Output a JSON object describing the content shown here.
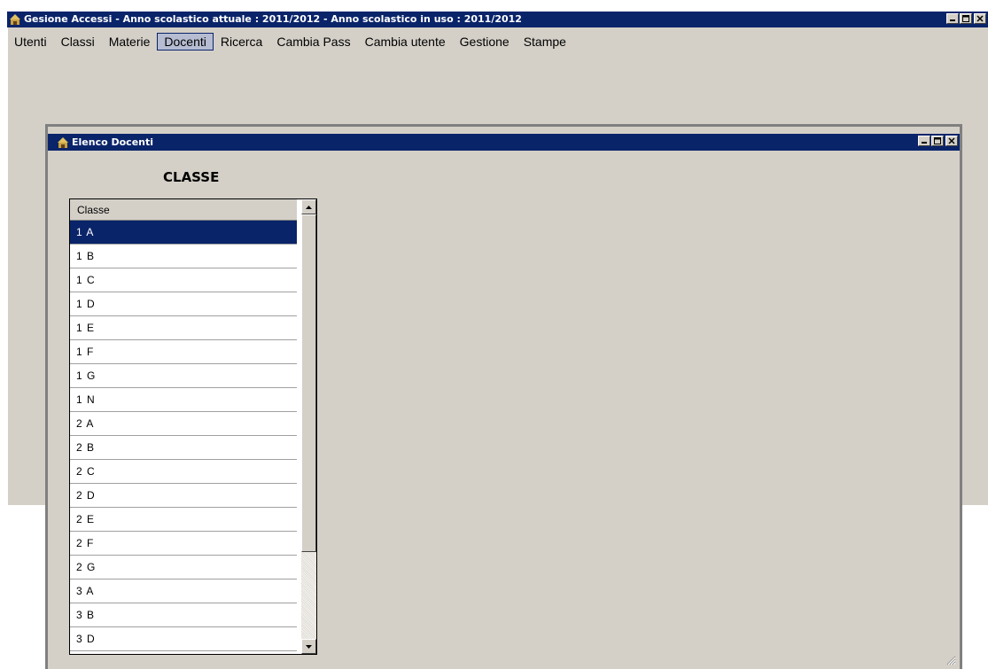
{
  "main_window": {
    "title": "Gesione Accessi - Anno scolastico attuale : 2011/2012 - Anno scolastico in uso : 2011/2012",
    "menu": [
      {
        "label": "Utenti"
      },
      {
        "label": "Classi"
      },
      {
        "label": "Materie"
      },
      {
        "label": "Docenti",
        "active": true
      },
      {
        "label": "Ricerca"
      },
      {
        "label": "Cambia Pass"
      },
      {
        "label": "Cambia utente"
      },
      {
        "label": "Gestione"
      },
      {
        "label": "Stampe"
      }
    ]
  },
  "child_window": {
    "title": "Elenco Docenti",
    "heading": "CLASSE",
    "grid": {
      "column_header": "Classe",
      "selected_index": 0,
      "rows": [
        "1 A",
        "1 B",
        "1 C",
        "1 D",
        "1 E",
        "1 F",
        "1 G",
        "1 N",
        "2 A",
        "2 B",
        "2 C",
        "2 D",
        "2 E",
        "2 F",
        "2 G",
        "3 A",
        "3 B",
        "3 D"
      ]
    }
  },
  "colors": {
    "titlebar": "#0a246a",
    "face": "#d4d0c8",
    "selection": "#0a246a",
    "menu_highlight": "#b6bdd2"
  }
}
